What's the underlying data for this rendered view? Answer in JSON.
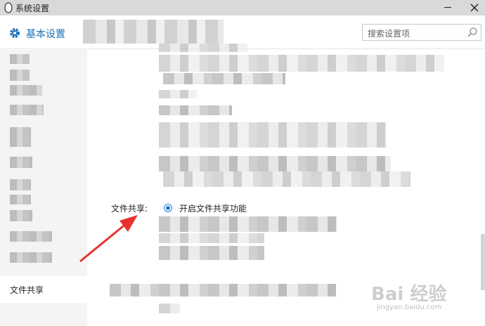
{
  "window": {
    "title": "系统设置"
  },
  "header": {
    "title": "基本设置",
    "accent": "#1a6fb5"
  },
  "search": {
    "placeholder": "搜索设置项"
  },
  "sidebar": {
    "active_item": "文件共享"
  },
  "content": {
    "section_label": "文件共享:",
    "radio_option": "开启文件共享功能",
    "radio_selected": true,
    "radio_color": "#1a78d0"
  },
  "annotation": {
    "arrow_color": "#e8322d"
  },
  "watermark": {
    "main": "Bai 经验",
    "sub": "jingyan.baidu.com"
  },
  "icons": [
    "penguin-icon",
    "gear-icon",
    "search-icon",
    "close-icon",
    "minimize-icon"
  ]
}
